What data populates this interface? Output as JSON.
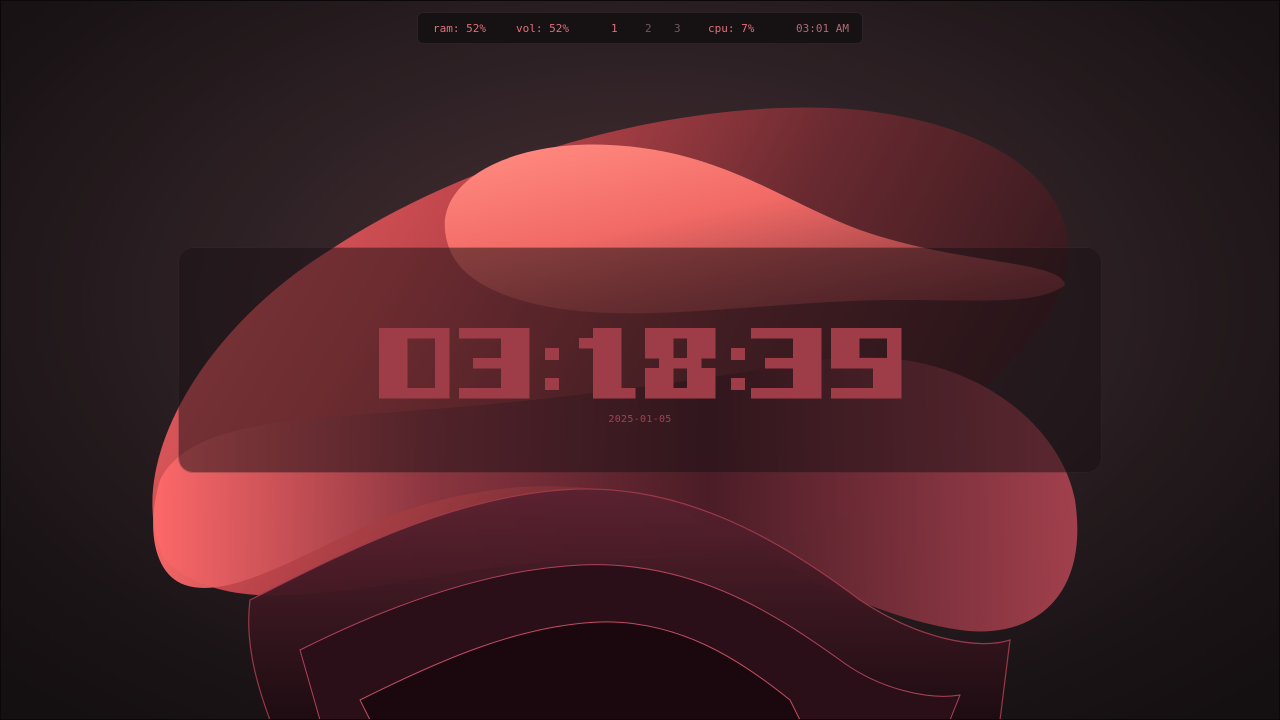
{
  "statusbar": {
    "ram": "ram: 52%",
    "vol": "vol: 52%",
    "workspaces": [
      "1",
      "2",
      "3"
    ],
    "active_workspace": "1",
    "cpu": "cpu: 7%",
    "time": "03:01 AM"
  },
  "clock": {
    "time": "03:18:39",
    "date": "2025-01-05"
  },
  "colors": {
    "accent": "#e0707a",
    "clock_digits": "#9e3c47",
    "inactive_workspace": "#6e5a5e"
  },
  "wallpaper": {
    "icon": "abstract-bloom-wallpaper"
  }
}
